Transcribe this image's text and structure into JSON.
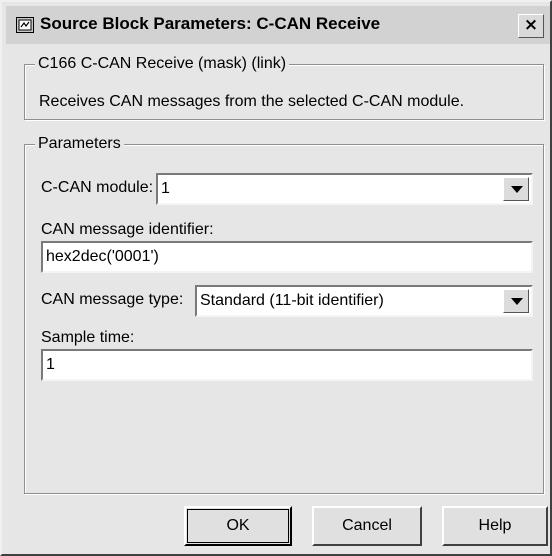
{
  "window": {
    "title": "Source Block Parameters: C-CAN Receive",
    "close_label": "×"
  },
  "description": {
    "group_label": "C166 C-CAN Receive (mask) (link)",
    "text": "Receives CAN messages from the selected C-CAN module."
  },
  "parameters": {
    "group_label": "Parameters",
    "ccan_module": {
      "label": "C-CAN module:",
      "value": "1"
    },
    "can_message_identifier": {
      "label": "CAN message identifier:",
      "value": "hex2dec('0001')"
    },
    "can_message_type": {
      "label": "CAN message type:",
      "value": "Standard (11-bit identifier)"
    },
    "sample_time": {
      "label": "Sample time:",
      "value": "1"
    }
  },
  "buttons": {
    "ok": "OK",
    "cancel": "Cancel",
    "help": "Help"
  }
}
